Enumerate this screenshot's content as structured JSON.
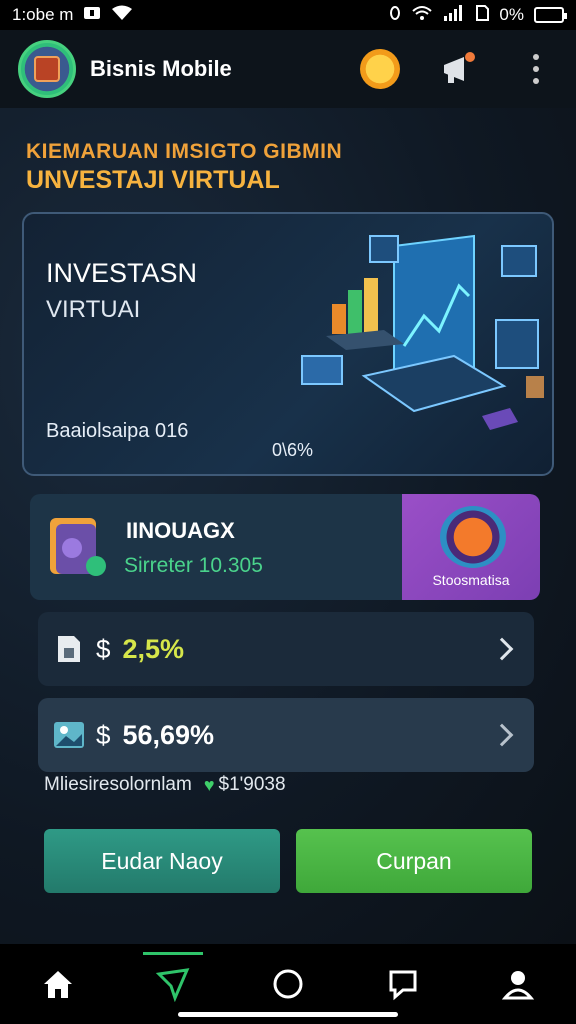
{
  "status_bar": {
    "time": "1:obe m",
    "battery": "0%"
  },
  "header": {
    "title": "Bisnis Mobile",
    "logo_icon": "crate-logo-icon",
    "actions": [
      "sun-icon",
      "megaphone-icon",
      "more-vertical-icon"
    ]
  },
  "headline": {
    "line1": "KIEMARUAN IMSIGTO GIBMIN",
    "line2": "UNVESTAJI VIRTUAL"
  },
  "hero": {
    "title": "INVESTASN",
    "subtitle": "VIRTUAI",
    "balance_label": "Baaiolsaipa  016",
    "percent": "0\\6%"
  },
  "promo": {
    "title": "IINOUAGX",
    "subtitle": "Sirreter 10.305",
    "badge_label": "Stoosmatisa"
  },
  "stats": [
    {
      "currency": "$",
      "value": "2,5%",
      "icon": "document-icon",
      "color": "#d6e64a"
    },
    {
      "currency": "$",
      "value": "56,69%",
      "icon": "image-icon",
      "color": "#ffffff"
    }
  ],
  "summary": {
    "label": "Mliesiresolornlam",
    "amount": "$1'9038",
    "heart_icon": "heart-icon"
  },
  "buttons": {
    "left_label": "Eudar Naoy",
    "right_label": "Curpan"
  },
  "bottom_nav": [
    "home-icon",
    "send-icon",
    "circle-icon",
    "chat-icon",
    "profile-icon"
  ]
}
